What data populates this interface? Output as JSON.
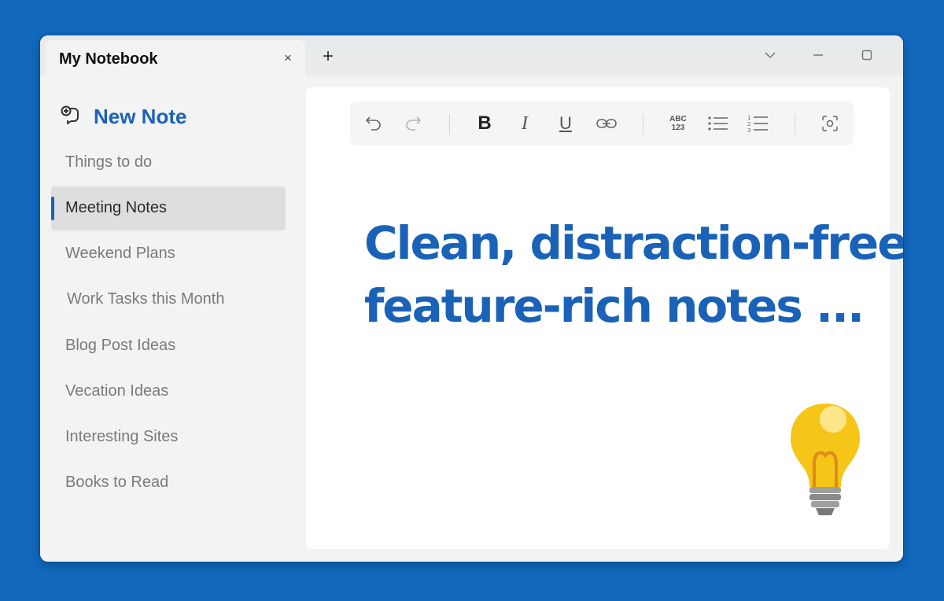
{
  "window": {
    "tab_title": "My Notebook",
    "tab_close": "×",
    "new_tab": "+"
  },
  "sidebar": {
    "new_note_label": "New Note",
    "items": [
      {
        "label": "Things to do"
      },
      {
        "label": "Meeting Notes",
        "active": true
      },
      {
        "label": "Weekend Plans"
      },
      {
        "label": "Work Tasks this Month"
      },
      {
        "label": "Blog Post Ideas"
      },
      {
        "label": "Vecation Ideas"
      },
      {
        "label": "Interesting Sites"
      },
      {
        "label": "Books to Read"
      }
    ]
  },
  "toolbar": {
    "buttons": [
      "undo-icon",
      "redo-icon",
      "bold-icon",
      "italic-icon",
      "underline-icon",
      "link-icon",
      "spellcheck-icon",
      "bulleted-list-icon",
      "numbered-list-icon",
      "focus-mode-icon"
    ],
    "bold_glyph": "B",
    "italic_glyph": "I",
    "underline_glyph": "U",
    "spell_top": "ABC",
    "spell_bottom": "123"
  },
  "editor": {
    "headline_line1": "Clean, distraction-free,",
    "headline_line2": "feature-rich notes ..."
  },
  "colors": {
    "background": "#1168bd",
    "accent": "#1a62b8",
    "bulb": "#f5c518"
  }
}
